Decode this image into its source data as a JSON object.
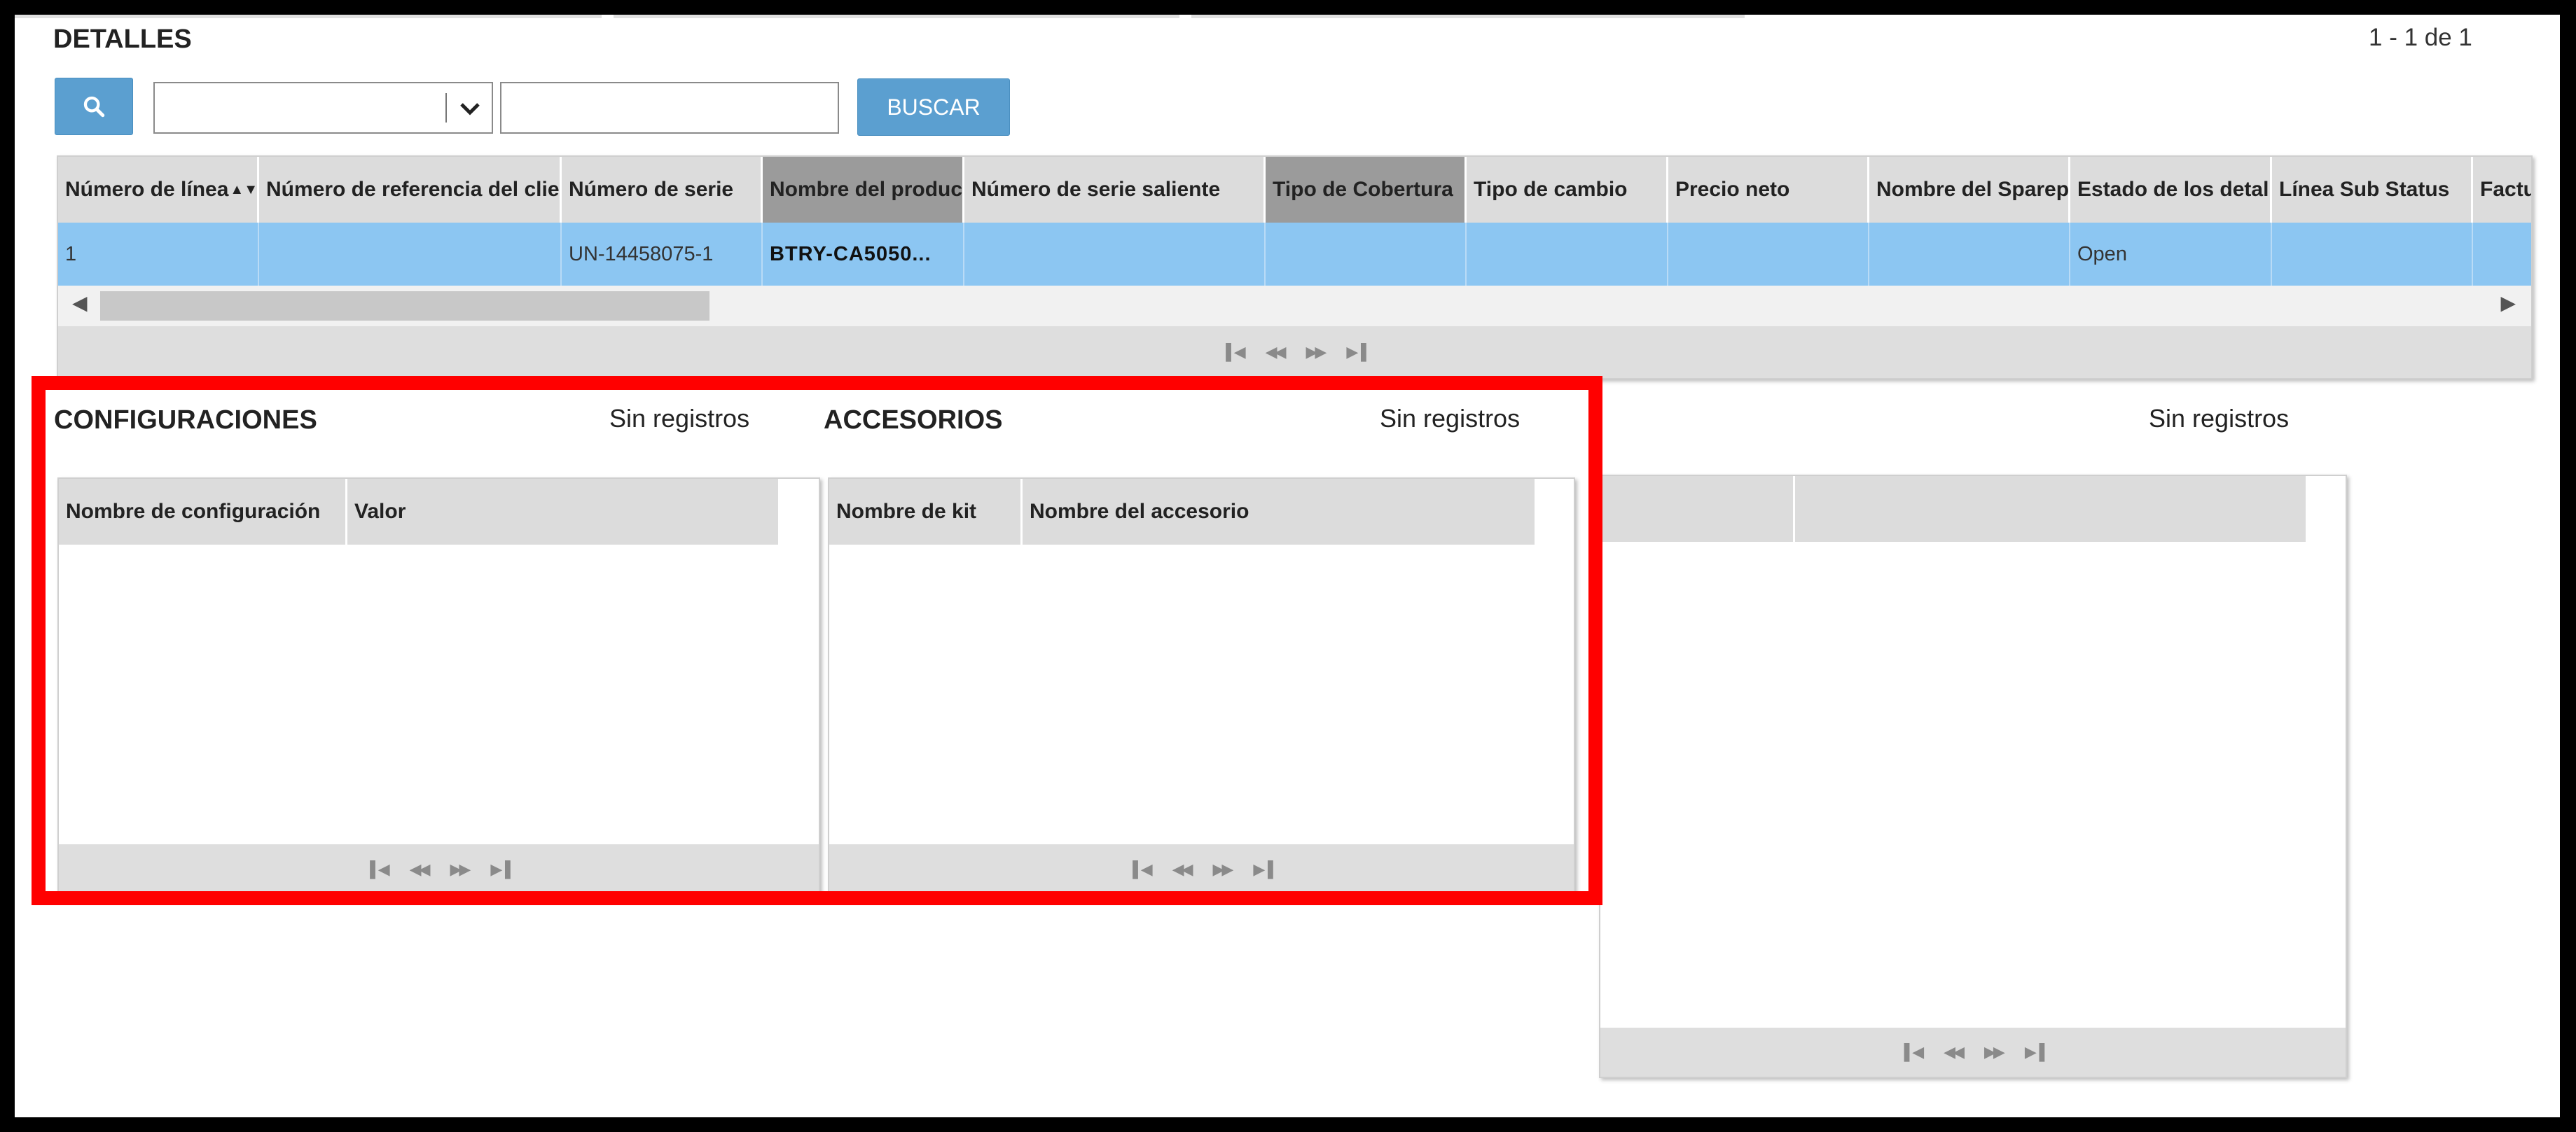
{
  "detalles": {
    "title": "DETALLES",
    "pagination_count": "1 - 1 de 1",
    "search_button_label": "BUSCAR",
    "search_field_select_value": "",
    "search_text_value": "",
    "columns": [
      "Número de línea",
      "Número de referencia del clie",
      "Número de serie",
      "Nombre del produc",
      "Número de serie saliente",
      "Tipo de Cobertura",
      "Tipo de cambio",
      "Precio neto",
      "Nombre del Sparep",
      "Estado de los detal",
      "Línea Sub Status",
      "Factu"
    ],
    "row": [
      "1",
      "",
      "UN-14458075-1",
      "BTRY-CA5050...",
      "",
      "",
      "",
      "",
      "",
      "Open",
      "",
      ""
    ],
    "sort_indicator": "▲▼"
  },
  "configuraciones": {
    "title": "CONFIGURACIONES",
    "empty_text": "Sin registros",
    "columns": [
      "Nombre de configuración",
      "Valor"
    ]
  },
  "accesorios": {
    "title": "ACCESORIOS",
    "empty_text": "Sin registros",
    "columns": [
      "Nombre de kit",
      "Nombre del accesorio"
    ]
  },
  "third_panel": {
    "empty_text": "Sin registros",
    "columns": [
      "",
      ""
    ]
  },
  "icons": {
    "search": "search-icon",
    "dropdown": "chevron-down-icon",
    "pager_first": "first-page-icon",
    "pager_prev": "prev-page-icon",
    "pager_next": "next-page-icon",
    "pager_last": "last-page-icon"
  },
  "colors": {
    "accent_blue": "#5b9fd0",
    "selected_row": "#8cc6f2",
    "highlight_border": "#ff0000"
  }
}
